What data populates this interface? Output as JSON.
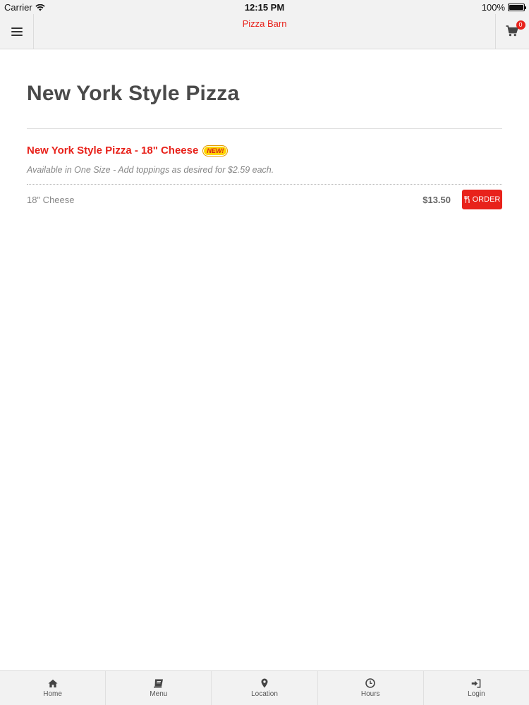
{
  "status_bar": {
    "carrier": "Carrier",
    "time": "12:15 PM",
    "battery": "100%",
    "battery_level": 1.0
  },
  "nav": {
    "title": "Pizza Barn",
    "cart_count": "0",
    "icons": {
      "menu": "hamburger-icon",
      "cart": "cart-icon"
    }
  },
  "page": {
    "title": "New York Style Pizza"
  },
  "item": {
    "name": "New York Style Pizza - 18\" Cheese",
    "badge": "NEW!",
    "description": "Available in One Size - Add toppings as desired for $2.59 each.",
    "options": [
      {
        "size": "18\" Cheese",
        "price": "$13.50",
        "order_label": "ORDER"
      }
    ]
  },
  "tabs": [
    {
      "label": "Home",
      "icon": "home-icon"
    },
    {
      "label": "Menu",
      "icon": "book-icon"
    },
    {
      "label": "Location",
      "icon": "location-pin-icon"
    },
    {
      "label": "Hours",
      "icon": "clock-icon"
    },
    {
      "label": "Login",
      "icon": "login-icon"
    }
  ],
  "colors": {
    "accent": "#e8221b",
    "bar_background": "#f2f2f2",
    "badge": "#ffd500"
  }
}
